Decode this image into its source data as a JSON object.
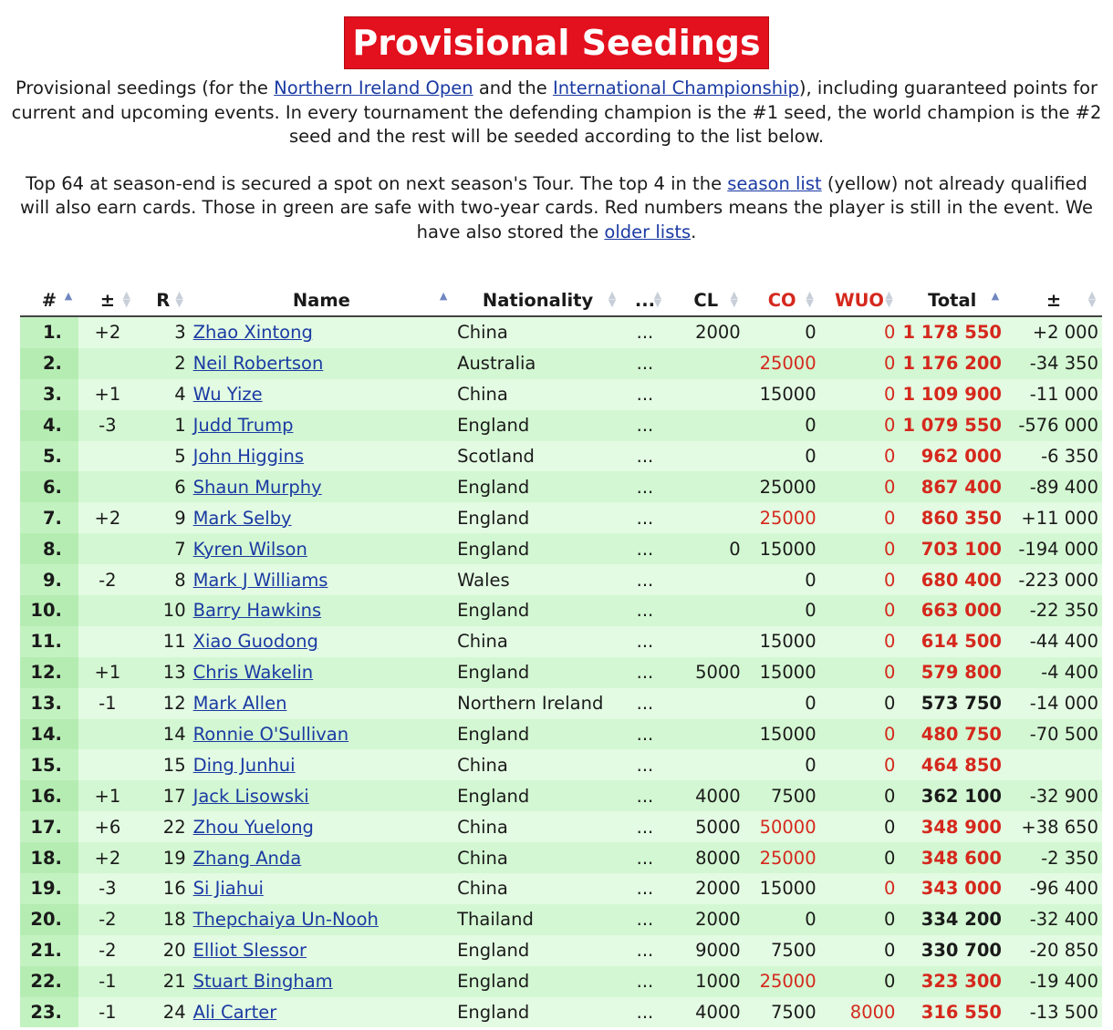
{
  "header": {
    "title": "Provisional Seedings"
  },
  "intro": {
    "p1_a": "Provisional seedings (for the ",
    "link_nio": "Northern Ireland Open",
    "p1_b": " and the ",
    "link_ic": "International Championship",
    "p1_c": "), including guaranteed points for current and upcoming events. In every tournament the defending champion is the #1 seed, the world champion is the #2 seed and the rest will be seeded according to the list below.",
    "p2_a": "Top 64 at season-end is secured a spot on next season's Tour. The top 4 in the ",
    "link_season": "season list",
    "p2_b": " (yellow) not already qualified will also earn cards. Those in green are safe with two-year cards. Red numbers means the player is still in the event. We have also stored the ",
    "link_older": "older lists",
    "p2_c": "."
  },
  "table": {
    "columns": {
      "rank": "#",
      "change": "±",
      "r": "R",
      "name": "Name",
      "nationality": "Nationality",
      "dots": "...",
      "cl": "CL",
      "co": "CO",
      "wuo": "WUO",
      "total": "Total",
      "diff": "±"
    },
    "colors": {
      "red": "#d5281d",
      "green_light": "#e3fbe2",
      "green_rank": "#c3f2c1",
      "link": "#1a3aa3"
    },
    "rows": [
      {
        "rank": "1.",
        "chg": "+2",
        "r": "3",
        "name": "Zhao Xintong",
        "nat": "China",
        "dots": "...",
        "cl": "2000",
        "co": "0",
        "co_red": false,
        "wuo": "0",
        "wuo_red": true,
        "total": "1 178 550",
        "total_red": true,
        "diff": "+2 000"
      },
      {
        "rank": "2.",
        "chg": "",
        "r": "2",
        "name": "Neil Robertson",
        "nat": "Australia",
        "dots": "...",
        "cl": "",
        "co": "25000",
        "co_red": true,
        "wuo": "0",
        "wuo_red": true,
        "total": "1 176 200",
        "total_red": true,
        "diff": "-34 350"
      },
      {
        "rank": "3.",
        "chg": "+1",
        "r": "4",
        "name": "Wu Yize",
        "nat": "China",
        "dots": "...",
        "cl": "",
        "co": "15000",
        "co_red": false,
        "wuo": "0",
        "wuo_red": true,
        "total": "1 109 900",
        "total_red": true,
        "diff": "-11 000"
      },
      {
        "rank": "4.",
        "chg": "-3",
        "r": "1",
        "name": "Judd Trump",
        "nat": "England",
        "dots": "...",
        "cl": "",
        "co": "0",
        "co_red": false,
        "wuo": "0",
        "wuo_red": true,
        "total": "1 079 550",
        "total_red": true,
        "diff": "-576 000"
      },
      {
        "rank": "5.",
        "chg": "",
        "r": "5",
        "name": "John Higgins",
        "nat": "Scotland",
        "dots": "...",
        "cl": "",
        "co": "0",
        "co_red": false,
        "wuo": "0",
        "wuo_red": true,
        "total": "962 000",
        "total_red": true,
        "diff": "-6 350"
      },
      {
        "rank": "6.",
        "chg": "",
        "r": "6",
        "name": "Shaun Murphy",
        "nat": "England",
        "dots": "...",
        "cl": "",
        "co": "25000",
        "co_red": false,
        "wuo": "0",
        "wuo_red": true,
        "total": "867 400",
        "total_red": true,
        "diff": "-89 400"
      },
      {
        "rank": "7.",
        "chg": "+2",
        "r": "9",
        "name": "Mark Selby",
        "nat": "England",
        "dots": "...",
        "cl": "",
        "co": "25000",
        "co_red": true,
        "wuo": "0",
        "wuo_red": true,
        "total": "860 350",
        "total_red": true,
        "diff": "+11 000"
      },
      {
        "rank": "8.",
        "chg": "",
        "r": "7",
        "name": "Kyren Wilson",
        "nat": "England",
        "dots": "...",
        "cl": "0",
        "co": "15000",
        "co_red": false,
        "wuo": "0",
        "wuo_red": true,
        "total": "703 100",
        "total_red": true,
        "diff": "-194 000"
      },
      {
        "rank": "9.",
        "chg": "-2",
        "r": "8",
        "name": "Mark J Williams",
        "nat": "Wales",
        "dots": "...",
        "cl": "",
        "co": "0",
        "co_red": false,
        "wuo": "0",
        "wuo_red": true,
        "total": "680 400",
        "total_red": true,
        "diff": "-223 000"
      },
      {
        "rank": "10.",
        "chg": "",
        "r": "10",
        "name": "Barry Hawkins",
        "nat": "England",
        "dots": "...",
        "cl": "",
        "co": "0",
        "co_red": false,
        "wuo": "0",
        "wuo_red": true,
        "total": "663 000",
        "total_red": true,
        "diff": "-22 350"
      },
      {
        "rank": "11.",
        "chg": "",
        "r": "11",
        "name": "Xiao Guodong",
        "nat": "China",
        "dots": "...",
        "cl": "",
        "co": "15000",
        "co_red": false,
        "wuo": "0",
        "wuo_red": true,
        "total": "614 500",
        "total_red": true,
        "diff": "-44 400"
      },
      {
        "rank": "12.",
        "chg": "+1",
        "r": "13",
        "name": "Chris Wakelin",
        "nat": "England",
        "dots": "...",
        "cl": "5000",
        "co": "15000",
        "co_red": false,
        "wuo": "0",
        "wuo_red": true,
        "total": "579 800",
        "total_red": true,
        "diff": "-4 400"
      },
      {
        "rank": "13.",
        "chg": "-1",
        "r": "12",
        "name": "Mark Allen",
        "nat": "Northern Ireland",
        "dots": "...",
        "cl": "",
        "co": "0",
        "co_red": false,
        "wuo": "0",
        "wuo_red": false,
        "total": "573 750",
        "total_red": false,
        "diff": "-14 000"
      },
      {
        "rank": "14.",
        "chg": "",
        "r": "14",
        "name": "Ronnie O'Sullivan",
        "nat": "England",
        "dots": "...",
        "cl": "",
        "co": "15000",
        "co_red": false,
        "wuo": "0",
        "wuo_red": true,
        "total": "480 750",
        "total_red": true,
        "diff": "-70 500"
      },
      {
        "rank": "15.",
        "chg": "",
        "r": "15",
        "name": "Ding Junhui",
        "nat": "China",
        "dots": "...",
        "cl": "",
        "co": "0",
        "co_red": false,
        "wuo": "0",
        "wuo_red": true,
        "total": "464 850",
        "total_red": true,
        "diff": ""
      },
      {
        "rank": "16.",
        "chg": "+1",
        "r": "17",
        "name": "Jack Lisowski",
        "nat": "England",
        "dots": "...",
        "cl": "4000",
        "co": "7500",
        "co_red": false,
        "wuo": "0",
        "wuo_red": false,
        "total": "362 100",
        "total_red": false,
        "diff": "-32 900"
      },
      {
        "rank": "17.",
        "chg": "+6",
        "r": "22",
        "name": "Zhou Yuelong",
        "nat": "China",
        "dots": "...",
        "cl": "5000",
        "co": "50000",
        "co_red": true,
        "wuo": "0",
        "wuo_red": false,
        "total": "348 900",
        "total_red": true,
        "diff": "+38 650"
      },
      {
        "rank": "18.",
        "chg": "+2",
        "r": "19",
        "name": "Zhang Anda",
        "nat": "China",
        "dots": "...",
        "cl": "8000",
        "co": "25000",
        "co_red": true,
        "wuo": "0",
        "wuo_red": false,
        "total": "348 600",
        "total_red": true,
        "diff": "-2 350"
      },
      {
        "rank": "19.",
        "chg": "-3",
        "r": "16",
        "name": "Si Jiahui",
        "nat": "China",
        "dots": "...",
        "cl": "2000",
        "co": "15000",
        "co_red": false,
        "wuo": "0",
        "wuo_red": true,
        "total": "343 000",
        "total_red": true,
        "diff": "-96 400"
      },
      {
        "rank": "20.",
        "chg": "-2",
        "r": "18",
        "name": "Thepchaiya Un-Nooh",
        "nat": "Thailand",
        "dots": "...",
        "cl": "2000",
        "co": "0",
        "co_red": false,
        "wuo": "0",
        "wuo_red": false,
        "total": "334 200",
        "total_red": false,
        "diff": "-32 400"
      },
      {
        "rank": "21.",
        "chg": "-2",
        "r": "20",
        "name": "Elliot Slessor",
        "nat": "England",
        "dots": "...",
        "cl": "9000",
        "co": "7500",
        "co_red": false,
        "wuo": "0",
        "wuo_red": false,
        "total": "330 700",
        "total_red": false,
        "diff": "-20 850"
      },
      {
        "rank": "22.",
        "chg": "-1",
        "r": "21",
        "name": "Stuart Bingham",
        "nat": "England",
        "dots": "...",
        "cl": "1000",
        "co": "25000",
        "co_red": true,
        "wuo": "0",
        "wuo_red": false,
        "total": "323 300",
        "total_red": true,
        "diff": "-19 400"
      },
      {
        "rank": "23.",
        "chg": "-1",
        "r": "24",
        "name": "Ali Carter",
        "nat": "England",
        "dots": "...",
        "cl": "4000",
        "co": "7500",
        "co_red": false,
        "wuo": "8000",
        "wuo_red": true,
        "total": "316 550",
        "total_red": true,
        "diff": "-13 500"
      }
    ]
  }
}
